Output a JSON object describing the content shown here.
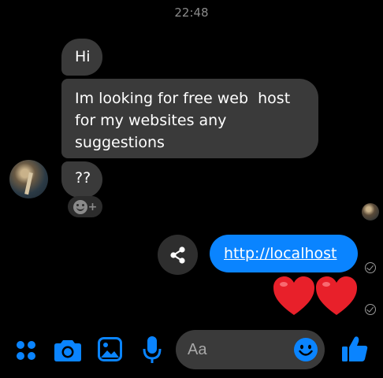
{
  "header": {
    "timestamp": "22:48"
  },
  "conversation": {
    "incoming": [
      {
        "text": "Hi"
      },
      {
        "text": "Im looking for free web  host\nfor my websites any\nsuggestions"
      },
      {
        "text": "??"
      }
    ],
    "outgoing": {
      "link_text": "http://localhost",
      "emoji": "❤️❤️"
    }
  },
  "composer": {
    "placeholder": "Aa",
    "value": ""
  },
  "icons": {
    "apps": "four-dots-icon",
    "camera": "camera-icon",
    "gallery": "image-icon",
    "mic": "microphone-icon",
    "emoji": "smiley-icon",
    "like": "thumbs-up-icon",
    "share": "share-icon",
    "react": "add-reaction-icon",
    "read_receipt": "check-circle-icon"
  },
  "colors": {
    "accent": "#0a84ff",
    "bubble_incoming": "#3a3a3a",
    "background": "#000000"
  }
}
